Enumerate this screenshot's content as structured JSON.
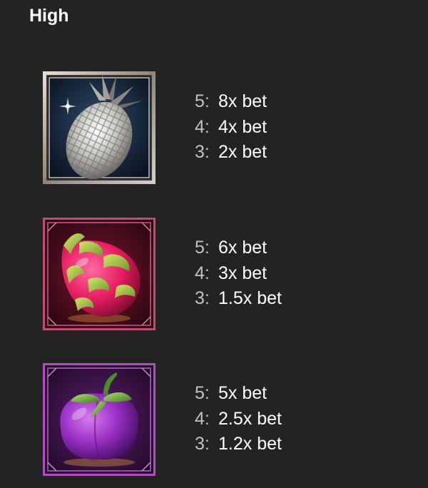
{
  "section": {
    "title": "High"
  },
  "symbols": [
    {
      "name": "Silver Pineapple",
      "icon": "pineapple-icon",
      "frame_color": "#b9b1aa",
      "pays": [
        {
          "count": "5:",
          "value": "8x bet"
        },
        {
          "count": "4:",
          "value": "4x bet"
        },
        {
          "count": "3:",
          "value": "2x bet"
        }
      ]
    },
    {
      "name": "Dragon Fruit",
      "icon": "dragon-fruit-icon",
      "frame_color": "#c24a73",
      "pays": [
        {
          "count": "5:",
          "value": "6x bet"
        },
        {
          "count": "4:",
          "value": "3x bet"
        },
        {
          "count": "3:",
          "value": "1.5x bet"
        }
      ]
    },
    {
      "name": "Purple Fruit",
      "icon": "purple-fruit-icon",
      "frame_color": "#b04fbf",
      "pays": [
        {
          "count": "5:",
          "value": "5x bet"
        },
        {
          "count": "4:",
          "value": "2.5x bet"
        },
        {
          "count": "3:",
          "value": "1.2x bet"
        }
      ]
    }
  ]
}
